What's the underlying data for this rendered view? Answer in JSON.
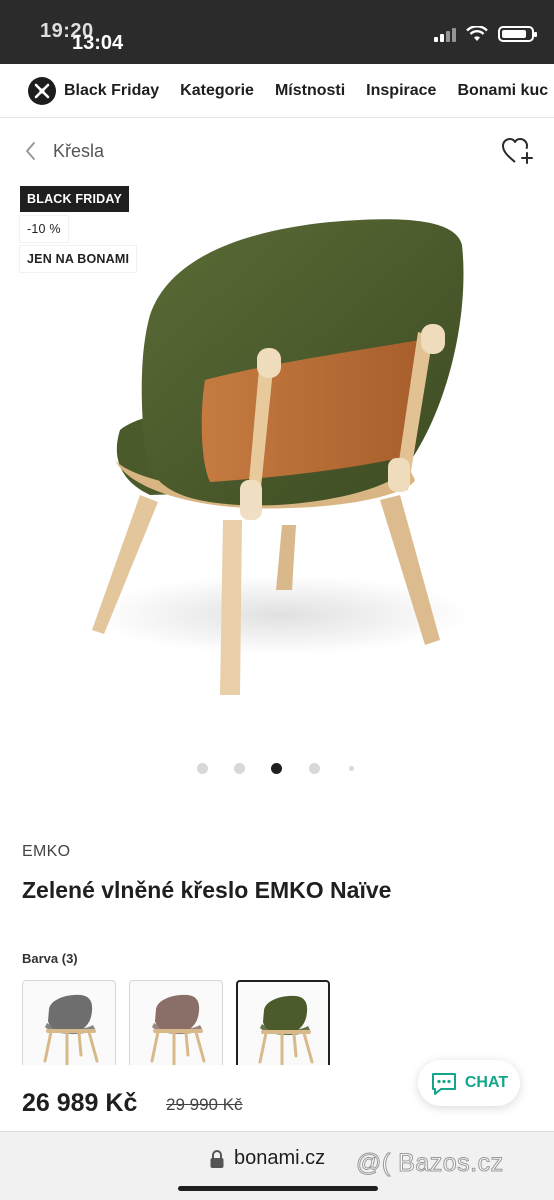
{
  "status_bar": {
    "time": "13:04",
    "time_ghost": "19:20",
    "battery_level": 0.85
  },
  "nav": {
    "logo_icon": "bonami-logo-icon",
    "items": [
      "Black Friday",
      "Kategorie",
      "Místnosti",
      "Inspirace",
      "Bonami kuc"
    ]
  },
  "breadcrumb": {
    "label": "Křesla"
  },
  "badges": [
    "BLACK FRIDAY",
    "-10 %",
    "JEN NA BONAMI"
  ],
  "gallery": {
    "count": 5,
    "active_index": 2
  },
  "product": {
    "brand": "EMKO",
    "title": "Zelené vlněné křeslo EMKO Naïve",
    "color_label": "Barva (3)",
    "swatches": [
      {
        "color": "#6e6e6e",
        "selected": false
      },
      {
        "color": "#8a6f68",
        "selected": false
      },
      {
        "color": "#4b5b2c",
        "selected": true
      }
    ]
  },
  "price": {
    "current": "26 989 Kč",
    "old": "29 990 Kč"
  },
  "chat": {
    "label": "CHAT"
  },
  "browser": {
    "url": "bonami.cz"
  },
  "watermark": "@( Bazos.cz",
  "colors": {
    "accent_green": "#14a58a",
    "chair_fabric": "#4b5b2c",
    "chair_leather": "#b06a35",
    "wood": "#e1c197"
  }
}
